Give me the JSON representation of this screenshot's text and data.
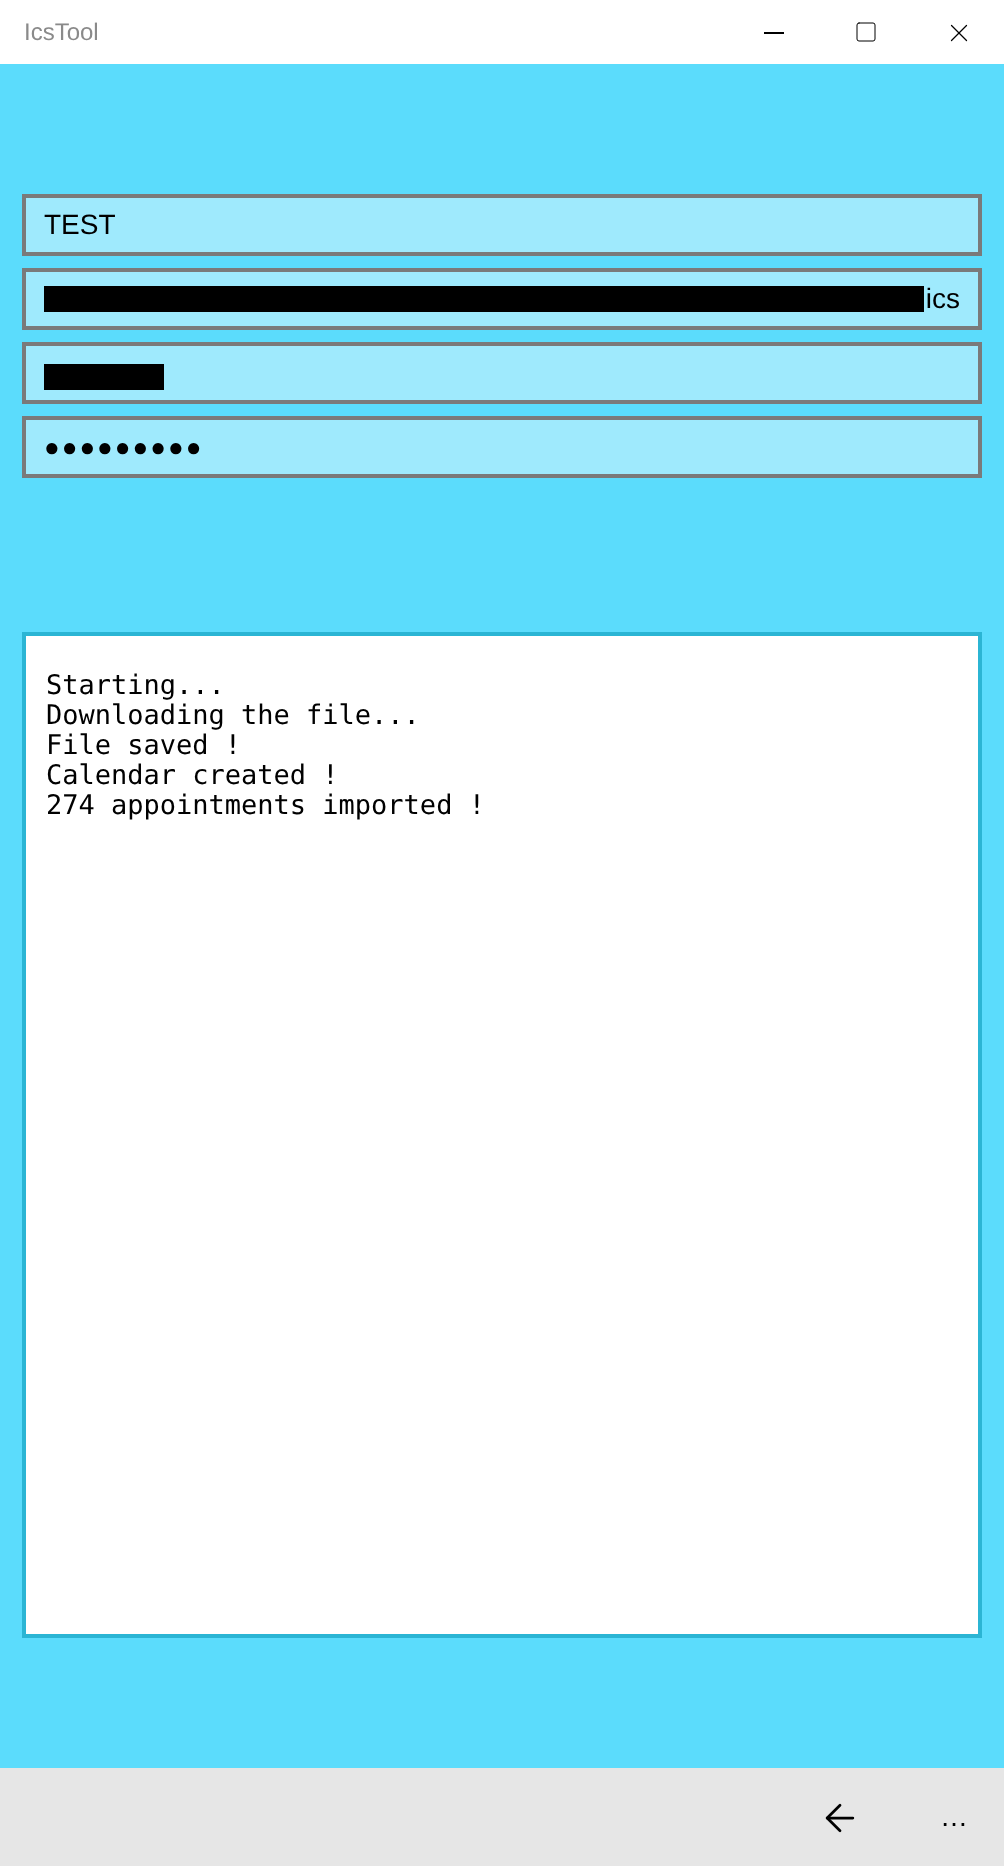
{
  "window": {
    "title": "IcsTool"
  },
  "fields": [
    {
      "kind": "text",
      "value": "TEST"
    },
    {
      "kind": "redacted",
      "value": "ics"
    },
    {
      "kind": "redacted"
    },
    {
      "kind": "password",
      "value": "●●●●●●●●●"
    }
  ],
  "log": [
    "Starting...",
    "Downloading the file...",
    "File saved !",
    "Calendar created !",
    "274 appointments imported !"
  ],
  "command_bar": {
    "more": "…"
  }
}
